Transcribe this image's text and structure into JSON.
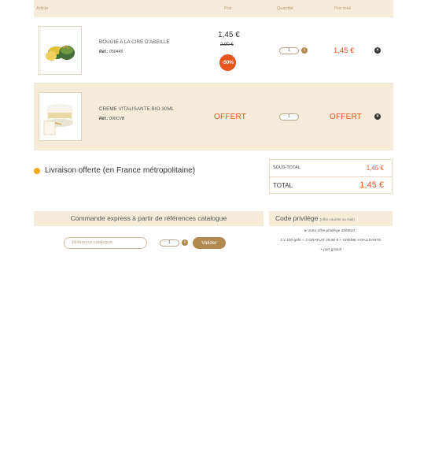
{
  "table": {
    "headers": {
      "article": "Article",
      "price": "Prix",
      "quantity": "Quantité",
      "total": "Prix total"
    }
  },
  "items": [
    {
      "name": "BOUGIE A LA CIRE D'ABEILLE",
      "ref_label": "Réf.:",
      "ref": "050445",
      "price": "1,45 €",
      "old_price": "2,90 €",
      "discount": "-50%",
      "quantity": "1",
      "total": "1,45 €"
    },
    {
      "name": "CREME VITALISANTE BIO 30ML",
      "ref_label": "Réf.:",
      "ref": "000CVB",
      "price": "OFFERT",
      "quantity": "1",
      "total": "OFFERT"
    }
  ],
  "shipping": {
    "text": "Livraison offerte (en France métropolitaine)"
  },
  "summary": {
    "subtotal_label": "SOUS-TOTAL",
    "subtotal_value": "1,45 €",
    "total_label": "TOTAL",
    "total_value": "1,45 €"
  },
  "express": {
    "title": "Commande express à partir de références catalogue",
    "input_placeholder": "Référence catalogue",
    "quantity": "1",
    "button_label": "Valider"
  },
  "promo": {
    "title": "Code privilège",
    "subtitle": "(offre courrier ou mail)",
    "line1": "▸ Votre offre privilège 23/0810 :",
    "line2": "2 x 100 gefe + 2 GRATUIT 29,90 € + CREME VITALISANTE",
    "line3": "+ port gratuit"
  },
  "colors": {
    "accent": "#e8541e",
    "beige": "#f6ecd9",
    "gold": "#b08a4e",
    "dot": "#f2a91a"
  },
  "icons": {
    "info": "info-icon",
    "remove": "remove-icon",
    "bullet": "bullet-dot-icon"
  }
}
